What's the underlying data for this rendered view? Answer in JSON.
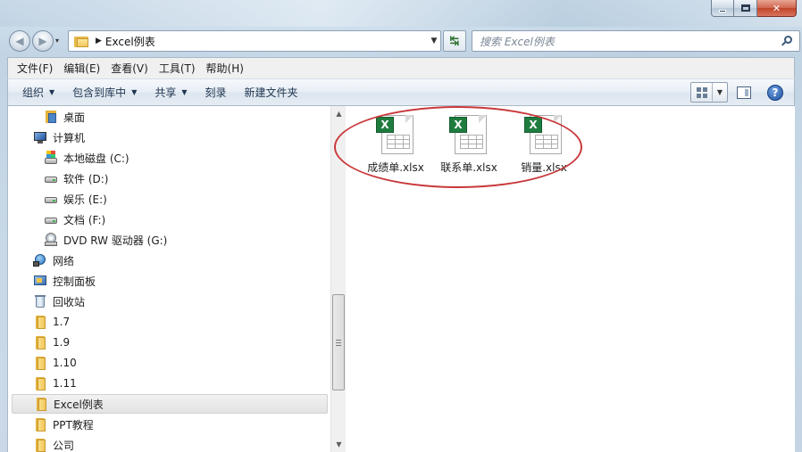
{
  "window": {
    "caption": {
      "minimize": "",
      "maximize": "",
      "close": "✕"
    }
  },
  "address_bar": {
    "crumb": "Excel例表",
    "dropdown": "▼"
  },
  "search": {
    "placeholder": "搜索 Excel例表"
  },
  "menu": [
    "文件(F)",
    "编辑(E)",
    "查看(V)",
    "工具(T)",
    "帮助(H)"
  ],
  "commands": {
    "organize": "组织",
    "include_library": "包含到库中",
    "share": "共享",
    "burn": "刻录",
    "new_folder": "新建文件夹"
  },
  "nav_tree": [
    {
      "label": "桌面",
      "icon": "desktop-icon"
    },
    {
      "label": "计算机",
      "icon": "computer-icon"
    },
    {
      "label": "本地磁盘 (C:)",
      "icon": "system-disk-icon"
    },
    {
      "label": "软件 (D:)",
      "icon": "disk-icon"
    },
    {
      "label": "娱乐 (E:)",
      "icon": "disk-icon"
    },
    {
      "label": "文档 (F:)",
      "icon": "disk-icon"
    },
    {
      "label": "DVD RW 驱动器 (G:)",
      "icon": "dvd-icon"
    },
    {
      "label": "网络",
      "icon": "network-icon"
    },
    {
      "label": "控制面板",
      "icon": "control-panel-icon"
    },
    {
      "label": "回收站",
      "icon": "recycle-bin-icon"
    },
    {
      "label": "1.7",
      "icon": "folder-icon"
    },
    {
      "label": "1.9",
      "icon": "folder-icon"
    },
    {
      "label": "1.10",
      "icon": "folder-icon"
    },
    {
      "label": "1.11",
      "icon": "folder-icon"
    },
    {
      "label": "Excel例表",
      "icon": "folder-icon",
      "selected": true
    },
    {
      "label": "PPT教程",
      "icon": "folder-icon"
    },
    {
      "label": "公司",
      "icon": "folder-icon"
    }
  ],
  "files": [
    {
      "name": "成绩单.xlsx"
    },
    {
      "name": "联系单.xlsx"
    },
    {
      "name": "销量.xlsx"
    }
  ],
  "colors": {
    "annotation": "#c8383b",
    "excel_green": "#1f7c3f"
  }
}
